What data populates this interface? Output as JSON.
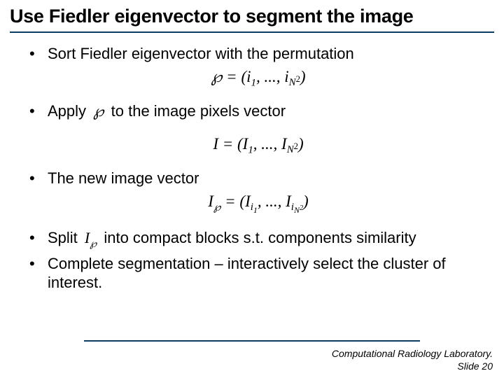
{
  "title": "Use Fiedler eigenvector to segment the image",
  "bullets": {
    "b1": "Sort Fiedler eigenvector with the permutation",
    "b2a": "Apply",
    "b2b": "to the image pixels vector",
    "b3": "The new image vector",
    "b4a": "Split",
    "b4b": "into compact blocks s.t. components similarity",
    "b5": "Complete segmentation – interactively select the cluster of interest."
  },
  "math": {
    "wp": "℘",
    "eq1_pre": "℘ = (i",
    "eq1_sub1": "1",
    "eq1_mid": ", ..., i",
    "eq1_subN": "N",
    "eq1_supN": "2",
    "eq1_post": ")",
    "eq2_pre": "I = (I",
    "eq2_sub1": "1",
    "eq2_mid": ", ..., I",
    "eq2_subN": "N",
    "eq2_supN": "2",
    "eq2_post": ")",
    "eq3_preI": "I",
    "eq3_subwp": "℘",
    "eq3_eq": " = (I",
    "eq3_subi1a": "i",
    "eq3_subi1b": "1",
    "eq3_mid": ", ..., I",
    "eq3_subiNa": "i",
    "eq3_subiNb": "N",
    "eq3_supN": "2",
    "eq3_post": ")",
    "inlineI": "I",
    "inlineI_sub": "℘"
  },
  "footer": {
    "line1": "Computational Radiology Laboratory.",
    "line2": "Slide 20"
  }
}
